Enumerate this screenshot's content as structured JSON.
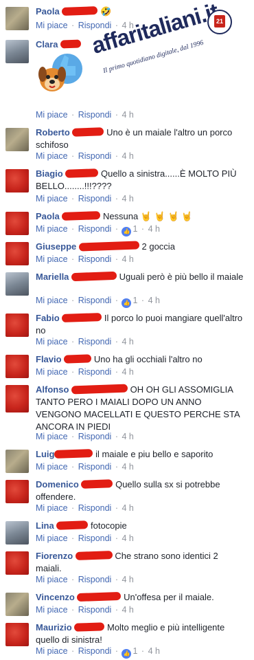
{
  "actions": {
    "like": "Mi piace",
    "reply": "Rispondi",
    "sep": "·"
  },
  "logo": {
    "main": "affaritaliani",
    "suffix": ".it",
    "tagline": "Il primo quotidiano digitale, dal 1996",
    "seal": "21"
  },
  "comments": [
    {
      "name": "Paola",
      "text": "",
      "emoji": "🤣",
      "time": "4 h",
      "likes": ""
    },
    {
      "name": "Clara",
      "text": "",
      "emoji": "",
      "time": "4 h",
      "likes": ""
    },
    {
      "name": "Roberto",
      "text": "Uno è un maiale l'altro un porco schifoso",
      "emoji": "",
      "time": "4 h",
      "likes": ""
    },
    {
      "name": "Biagio",
      "text": "Quello a sinistra......È MOLTO PIÙ BELLO........!!!????",
      "emoji": "",
      "time": "4 h",
      "likes": ""
    },
    {
      "name": "Paola",
      "text": "Nessuna",
      "emoji": "🤘 🤘 🤘 🤘",
      "time": "4 h",
      "likes": "1"
    },
    {
      "name": "Giuseppe",
      "text": "2 goccia",
      "emoji": "",
      "time": "4 h",
      "likes": ""
    },
    {
      "name": "Mariella",
      "text": "Uguali però è più bello il maiale",
      "emoji": "",
      "time": "4 h",
      "likes": "1"
    },
    {
      "name": "Fabio",
      "text": "Il porco lo puoi mangiare quell'altro no",
      "emoji": "",
      "time": "4 h",
      "likes": ""
    },
    {
      "name": "Flavio",
      "text": "Uno ha gli occhiali l'altro no",
      "emoji": "",
      "time": "4 h",
      "likes": ""
    },
    {
      "name": "Alfonso",
      "text": "OH OH GLI ASSOMIGLIA TANTO PERO I MAIALI DOPO UN ANNO VENGONO MACELLATI E QUESTO PERCHE STA ANCORA IN PIEDI",
      "emoji": "",
      "time": "4 h",
      "likes": ""
    },
    {
      "name": "Luig",
      "text": "il maiale e piu bello e saporito",
      "emoji": "",
      "time": "4 h",
      "likes": ""
    },
    {
      "name": "Domenico",
      "text": "Quello sulla sx si potrebbe offendere.",
      "emoji": "",
      "time": "4 h",
      "likes": ""
    },
    {
      "name": "Lina",
      "text": "fotocopie",
      "emoji": "",
      "time": "4 h",
      "likes": ""
    },
    {
      "name": "Fiorenzo",
      "text": "Che strano sono identici 2 maiali.",
      "emoji": "",
      "time": "4 h",
      "likes": ""
    },
    {
      "name": "Vincenzo",
      "text": "Un'offesa per il maiale.",
      "emoji": "",
      "time": "4 h",
      "likes": ""
    },
    {
      "name": "Maurizio",
      "text": "Molto meglio e più intelligente quello di sinistra!",
      "emoji": "",
      "time": "4 h",
      "likes": "1"
    }
  ]
}
